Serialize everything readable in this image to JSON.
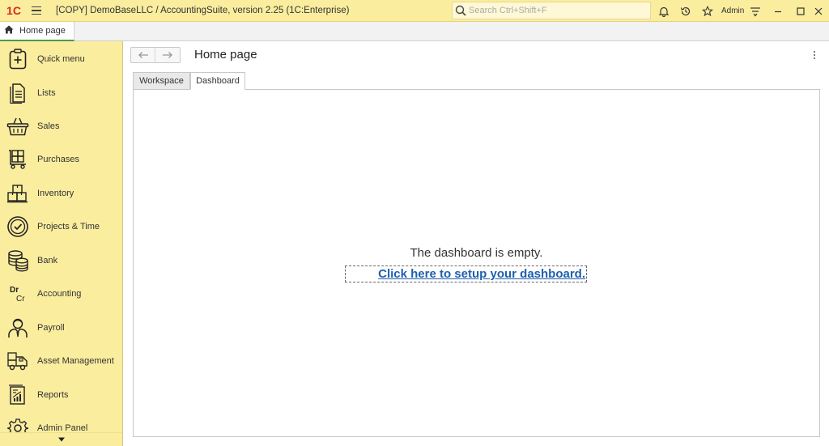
{
  "titlebar": {
    "logo": "1С",
    "title": "[COPY] DemoBaseLLC / AccountingSuite, version 2.25  (1C:Enterprise)",
    "search_placeholder": "Search Ctrl+Shift+F",
    "user": "Admin"
  },
  "tabs": {
    "home_label": "Home page"
  },
  "sidebar": {
    "items": [
      {
        "label": "Quick menu",
        "icon": "quick-menu-icon"
      },
      {
        "label": "Lists",
        "icon": "lists-icon"
      },
      {
        "label": "Sales",
        "icon": "basket-icon"
      },
      {
        "label": "Purchases",
        "icon": "cart-icon"
      },
      {
        "label": "Inventory",
        "icon": "boxes-icon"
      },
      {
        "label": "Projects & Time",
        "icon": "projects-clock-icon"
      },
      {
        "label": "Bank",
        "icon": "coins-icon"
      },
      {
        "label": "Accounting",
        "icon": "dr-cr-icon"
      },
      {
        "label": "Payroll",
        "icon": "person-icon"
      },
      {
        "label": "Asset Management",
        "icon": "truck-icon"
      },
      {
        "label": "Reports",
        "icon": "report-chart-icon"
      },
      {
        "label": "Admin Panel",
        "icon": "gear-icon"
      }
    ]
  },
  "main": {
    "title": "Home page",
    "tabs": [
      "Workspace",
      "Dashboard"
    ],
    "active_tab": "Dashboard",
    "empty_message": "The dashboard is empty.",
    "setup_link": "Click here to setup your dashboard."
  },
  "colors": {
    "sidebar_bg": "#fbed9e",
    "link": "#1d5fae",
    "logo_red": "#d42a1e"
  }
}
